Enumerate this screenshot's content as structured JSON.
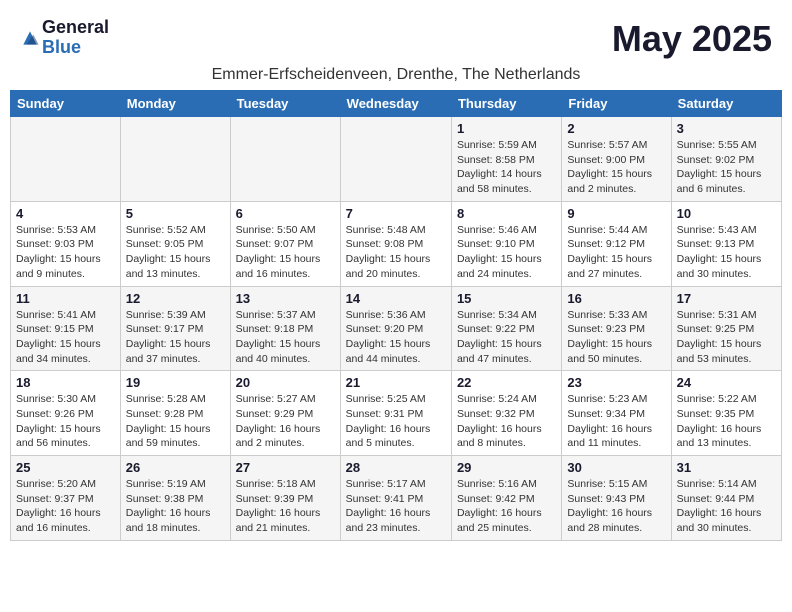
{
  "header": {
    "logo_general": "General",
    "logo_blue": "Blue",
    "month_title": "May 2025",
    "subtitle": "Emmer-Erfscheidenveen, Drenthe, The Netherlands"
  },
  "days_of_week": [
    "Sunday",
    "Monday",
    "Tuesday",
    "Wednesday",
    "Thursday",
    "Friday",
    "Saturday"
  ],
  "weeks": [
    [
      {
        "day": "",
        "info": ""
      },
      {
        "day": "",
        "info": ""
      },
      {
        "day": "",
        "info": ""
      },
      {
        "day": "",
        "info": ""
      },
      {
        "day": "1",
        "info": "Sunrise: 5:59 AM\nSunset: 8:58 PM\nDaylight: 14 hours\nand 58 minutes."
      },
      {
        "day": "2",
        "info": "Sunrise: 5:57 AM\nSunset: 9:00 PM\nDaylight: 15 hours\nand 2 minutes."
      },
      {
        "day": "3",
        "info": "Sunrise: 5:55 AM\nSunset: 9:02 PM\nDaylight: 15 hours\nand 6 minutes."
      }
    ],
    [
      {
        "day": "4",
        "info": "Sunrise: 5:53 AM\nSunset: 9:03 PM\nDaylight: 15 hours\nand 9 minutes."
      },
      {
        "day": "5",
        "info": "Sunrise: 5:52 AM\nSunset: 9:05 PM\nDaylight: 15 hours\nand 13 minutes."
      },
      {
        "day": "6",
        "info": "Sunrise: 5:50 AM\nSunset: 9:07 PM\nDaylight: 15 hours\nand 16 minutes."
      },
      {
        "day": "7",
        "info": "Sunrise: 5:48 AM\nSunset: 9:08 PM\nDaylight: 15 hours\nand 20 minutes."
      },
      {
        "day": "8",
        "info": "Sunrise: 5:46 AM\nSunset: 9:10 PM\nDaylight: 15 hours\nand 24 minutes."
      },
      {
        "day": "9",
        "info": "Sunrise: 5:44 AM\nSunset: 9:12 PM\nDaylight: 15 hours\nand 27 minutes."
      },
      {
        "day": "10",
        "info": "Sunrise: 5:43 AM\nSunset: 9:13 PM\nDaylight: 15 hours\nand 30 minutes."
      }
    ],
    [
      {
        "day": "11",
        "info": "Sunrise: 5:41 AM\nSunset: 9:15 PM\nDaylight: 15 hours\nand 34 minutes."
      },
      {
        "day": "12",
        "info": "Sunrise: 5:39 AM\nSunset: 9:17 PM\nDaylight: 15 hours\nand 37 minutes."
      },
      {
        "day": "13",
        "info": "Sunrise: 5:37 AM\nSunset: 9:18 PM\nDaylight: 15 hours\nand 40 minutes."
      },
      {
        "day": "14",
        "info": "Sunrise: 5:36 AM\nSunset: 9:20 PM\nDaylight: 15 hours\nand 44 minutes."
      },
      {
        "day": "15",
        "info": "Sunrise: 5:34 AM\nSunset: 9:22 PM\nDaylight: 15 hours\nand 47 minutes."
      },
      {
        "day": "16",
        "info": "Sunrise: 5:33 AM\nSunset: 9:23 PM\nDaylight: 15 hours\nand 50 minutes."
      },
      {
        "day": "17",
        "info": "Sunrise: 5:31 AM\nSunset: 9:25 PM\nDaylight: 15 hours\nand 53 minutes."
      }
    ],
    [
      {
        "day": "18",
        "info": "Sunrise: 5:30 AM\nSunset: 9:26 PM\nDaylight: 15 hours\nand 56 minutes."
      },
      {
        "day": "19",
        "info": "Sunrise: 5:28 AM\nSunset: 9:28 PM\nDaylight: 15 hours\nand 59 minutes."
      },
      {
        "day": "20",
        "info": "Sunrise: 5:27 AM\nSunset: 9:29 PM\nDaylight: 16 hours\nand 2 minutes."
      },
      {
        "day": "21",
        "info": "Sunrise: 5:25 AM\nSunset: 9:31 PM\nDaylight: 16 hours\nand 5 minutes."
      },
      {
        "day": "22",
        "info": "Sunrise: 5:24 AM\nSunset: 9:32 PM\nDaylight: 16 hours\nand 8 minutes."
      },
      {
        "day": "23",
        "info": "Sunrise: 5:23 AM\nSunset: 9:34 PM\nDaylight: 16 hours\nand 11 minutes."
      },
      {
        "day": "24",
        "info": "Sunrise: 5:22 AM\nSunset: 9:35 PM\nDaylight: 16 hours\nand 13 minutes."
      }
    ],
    [
      {
        "day": "25",
        "info": "Sunrise: 5:20 AM\nSunset: 9:37 PM\nDaylight: 16 hours\nand 16 minutes."
      },
      {
        "day": "26",
        "info": "Sunrise: 5:19 AM\nSunset: 9:38 PM\nDaylight: 16 hours\nand 18 minutes."
      },
      {
        "day": "27",
        "info": "Sunrise: 5:18 AM\nSunset: 9:39 PM\nDaylight: 16 hours\nand 21 minutes."
      },
      {
        "day": "28",
        "info": "Sunrise: 5:17 AM\nSunset: 9:41 PM\nDaylight: 16 hours\nand 23 minutes."
      },
      {
        "day": "29",
        "info": "Sunrise: 5:16 AM\nSunset: 9:42 PM\nDaylight: 16 hours\nand 25 minutes."
      },
      {
        "day": "30",
        "info": "Sunrise: 5:15 AM\nSunset: 9:43 PM\nDaylight: 16 hours\nand 28 minutes."
      },
      {
        "day": "31",
        "info": "Sunrise: 5:14 AM\nSunset: 9:44 PM\nDaylight: 16 hours\nand 30 minutes."
      }
    ]
  ]
}
